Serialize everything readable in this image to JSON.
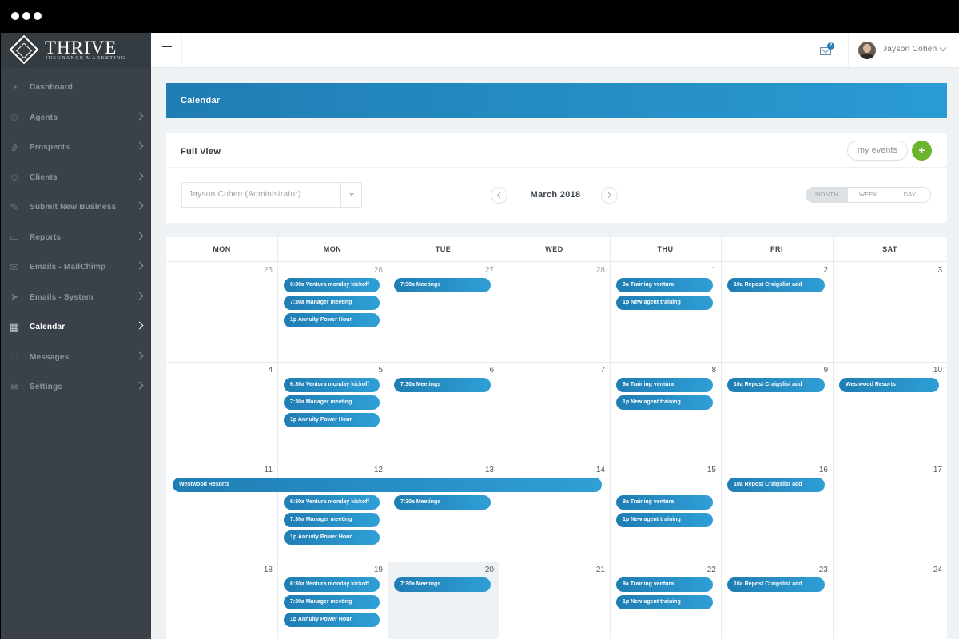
{
  "brand": {
    "title": "THRIVE",
    "subtitle": "INSURANCE MARKETING"
  },
  "sidebar": {
    "items": [
      {
        "label": "Dashboard",
        "icon": "dashboard-icon",
        "chevron": false,
        "active": false
      },
      {
        "label": "Agents",
        "icon": "agents-icon",
        "chevron": true,
        "active": false
      },
      {
        "label": "Prospects",
        "icon": "paperclip-icon",
        "chevron": true,
        "active": false
      },
      {
        "label": "Clients",
        "icon": "clients-icon",
        "chevron": true,
        "active": false
      },
      {
        "label": "Submit New Business",
        "icon": "pencil-icon",
        "chevron": true,
        "active": false
      },
      {
        "label": "Reports",
        "icon": "folder-icon",
        "chevron": true,
        "active": false
      },
      {
        "label": "Emails - MailChimp",
        "icon": "envelope-icon",
        "chevron": true,
        "active": false
      },
      {
        "label": "Emails - System",
        "icon": "paper-plane-icon",
        "chevron": true,
        "active": false
      },
      {
        "label": "Calendar",
        "icon": "calendar-icon",
        "chevron": true,
        "active": true
      },
      {
        "label": "Messages",
        "icon": "chat-icon",
        "chevron": true,
        "active": false
      },
      {
        "label": "Settings",
        "icon": "gear-icon",
        "chevron": true,
        "active": false
      }
    ]
  },
  "topbar": {
    "mail_badge": "2",
    "user_name": "Jayson Cohen"
  },
  "page": {
    "banner_title": "Calendar",
    "panel_title": "Full View",
    "my_events_label": "my events",
    "add_label": "+",
    "user_select_value": "Jayson Cohen (Administrator)",
    "month_label": "March 2018",
    "views": [
      "MONTH",
      "WEEK",
      "DAY"
    ],
    "accent_color": "#2a9bd3",
    "add_color": "#6ab52d"
  },
  "calendar": {
    "days_of_week": [
      "MON",
      "MON",
      "TUE",
      "WED",
      "THU",
      "FRI",
      "SAT"
    ],
    "weeks": [
      {
        "days": [
          "25",
          "26",
          "27",
          "28",
          "1",
          "2",
          "3"
        ],
        "muted": [
          true,
          true,
          true,
          true,
          false,
          false,
          false
        ]
      },
      {
        "days": [
          "4",
          "5",
          "6",
          "7",
          "8",
          "9",
          "10"
        ],
        "muted": [
          false,
          false,
          false,
          false,
          false,
          false,
          false
        ]
      },
      {
        "days": [
          "11",
          "12",
          "13",
          "14",
          "15",
          "16",
          "17"
        ],
        "muted": [
          false,
          false,
          false,
          false,
          false,
          false,
          false
        ]
      },
      {
        "days": [
          "18",
          "19",
          "20",
          "21",
          "22",
          "23",
          "24"
        ],
        "muted": [
          false,
          false,
          false,
          false,
          false,
          false,
          false
        ]
      }
    ],
    "today": {
      "week": 3,
      "col": 2
    },
    "events": [
      {
        "week": 0,
        "col": 1,
        "slot": 0,
        "span": 1,
        "label": "6:30a Ventura monday kickoff"
      },
      {
        "week": 0,
        "col": 1,
        "slot": 1,
        "span": 1,
        "label": "7:30a Manager meeting"
      },
      {
        "week": 0,
        "col": 1,
        "slot": 2,
        "span": 1,
        "label": "1p Annuity Power Hour"
      },
      {
        "week": 0,
        "col": 2,
        "slot": 0,
        "span": 1,
        "label": "7:30a Meetings"
      },
      {
        "week": 0,
        "col": 4,
        "slot": 0,
        "span": 1,
        "label": "9a Training ventura"
      },
      {
        "week": 0,
        "col": 4,
        "slot": 1,
        "span": 1,
        "label": "1p New agent training"
      },
      {
        "week": 0,
        "col": 5,
        "slot": 0,
        "span": 1,
        "label": "10a Repost Craigslist add"
      },
      {
        "week": 1,
        "col": 1,
        "slot": 0,
        "span": 1,
        "label": "6:30a Ventura monday kickoff"
      },
      {
        "week": 1,
        "col": 1,
        "slot": 1,
        "span": 1,
        "label": "7:30a Manager meeting"
      },
      {
        "week": 1,
        "col": 1,
        "slot": 2,
        "span": 1,
        "label": "1p Annuity Power Hour"
      },
      {
        "week": 1,
        "col": 2,
        "slot": 0,
        "span": 1,
        "label": "7:30a Meetings"
      },
      {
        "week": 1,
        "col": 4,
        "slot": 0,
        "span": 1,
        "label": "9a Training ventura"
      },
      {
        "week": 1,
        "col": 4,
        "slot": 1,
        "span": 1,
        "label": "1p New agent training"
      },
      {
        "week": 1,
        "col": 5,
        "slot": 0,
        "span": 1,
        "label": "10a Repost Craigslist add"
      },
      {
        "week": 1,
        "col": 6,
        "slot": 0,
        "span": 1,
        "label": "Westwood Resorts"
      },
      {
        "week": 2,
        "col": 0,
        "slot": 0,
        "span": 4,
        "label": "Westwood Resorts"
      },
      {
        "week": 2,
        "col": 1,
        "slot": 1,
        "span": 1,
        "label": "6:30a Ventura monday kickoff"
      },
      {
        "week": 2,
        "col": 1,
        "slot": 2,
        "span": 1,
        "label": "7:30a Manager meeting"
      },
      {
        "week": 2,
        "col": 1,
        "slot": 3,
        "span": 1,
        "label": "1p Annuity Power Hour"
      },
      {
        "week": 2,
        "col": 2,
        "slot": 1,
        "span": 1,
        "label": "7:30a Meetings"
      },
      {
        "week": 2,
        "col": 4,
        "slot": 1,
        "span": 1,
        "label": "9a Training ventura"
      },
      {
        "week": 2,
        "col": 4,
        "slot": 2,
        "span": 1,
        "label": "1p New agent training"
      },
      {
        "week": 2,
        "col": 5,
        "slot": 0,
        "span": 1,
        "label": "10a Repost Craigslist add"
      },
      {
        "week": 3,
        "col": 1,
        "slot": 0,
        "span": 1,
        "label": "6:30a Ventura monday kickoff"
      },
      {
        "week": 3,
        "col": 1,
        "slot": 1,
        "span": 1,
        "label": "7:30a Manager meeting"
      },
      {
        "week": 3,
        "col": 1,
        "slot": 2,
        "span": 1,
        "label": "1p Annuity Power Hour"
      },
      {
        "week": 3,
        "col": 2,
        "slot": 0,
        "span": 1,
        "label": "7:30a Meetings"
      },
      {
        "week": 3,
        "col": 4,
        "slot": 0,
        "span": 1,
        "label": "9a Training ventura"
      },
      {
        "week": 3,
        "col": 4,
        "slot": 1,
        "span": 1,
        "label": "1p New agent training"
      },
      {
        "week": 3,
        "col": 5,
        "slot": 0,
        "span": 1,
        "label": "10a Repost Craigslist add"
      }
    ]
  }
}
